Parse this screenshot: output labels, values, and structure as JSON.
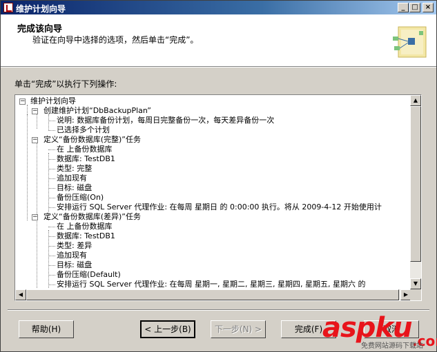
{
  "window": {
    "title": "维护计划向导"
  },
  "header": {
    "title": "完成该向导",
    "subtitle": "验证在向导中选择的选项，然后单击“完成”。"
  },
  "prompt": "单击“完成”以执行下列操作:",
  "tree": [
    {
      "text": "维护计划向导"
    },
    {
      "text": "创建维护计划“DbBackupPlan”"
    },
    {
      "text": "说明: 数据库备份计划，每周日完整备份一次，每天差异备份一次"
    },
    {
      "text": "已选择多个计划"
    },
    {
      "text": "定义“备份数据库(完整)”任务"
    },
    {
      "text": "在  上备份数据库"
    },
    {
      "text": "数据库: TestDB1"
    },
    {
      "text": "类型: 完整"
    },
    {
      "text": "追加现有"
    },
    {
      "text": "目标: 磁盘"
    },
    {
      "text": "备份压缩(On)"
    },
    {
      "text": "安排运行 SQL Server 代理作业: 在每周 星期日 的 0:00:00 执行。将从 2009-4-12 开始使用计"
    },
    {
      "text": "定义“备份数据库(差异)”任务"
    },
    {
      "text": "在  上备份数据库"
    },
    {
      "text": "数据库: TestDB1"
    },
    {
      "text": "类型: 差异"
    },
    {
      "text": "追加现有"
    },
    {
      "text": "目标: 磁盘"
    },
    {
      "text": "备份压缩(Default)"
    },
    {
      "text": "安排运行 SQL Server 代理作业: 在每周 星期一, 星期二, 星期三, 星期四, 星期五, 星期六 的"
    }
  ],
  "buttons": {
    "help": "帮助(H)",
    "back": "< 上一步(B)",
    "next": "下一步(N) >",
    "finish": "完成(F)",
    "cancel": "取消"
  },
  "watermark": {
    "brand": "aspku",
    "domain": ".com",
    "tagline": "免费网站源码下载站"
  }
}
